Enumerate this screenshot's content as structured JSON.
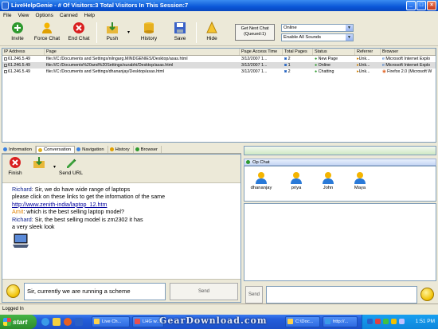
{
  "window": {
    "title": "LiveHelpGenie - # Of Visitors:3 Total Visitors In This Session:7"
  },
  "menu": [
    "File",
    "View",
    "Options",
    "Canned",
    "Help"
  ],
  "toolbar": {
    "invite": "Invite",
    "force_chat": "Force Chat",
    "end_chat": "End Chat",
    "push": "Push",
    "history": "History",
    "save": "Save",
    "hide": "Hide",
    "get_next_chat": "Get Next Chat",
    "queued": "(Queued:1)",
    "status_value": "Online",
    "sound_value": "Enable All Sounds"
  },
  "visitors": {
    "columns": [
      "IP Address",
      "Page",
      "Page Access Time",
      "Total Pages",
      "Status",
      "Referrer",
      "Browser"
    ],
    "rows": [
      {
        "ip": "61.246.5.49",
        "page": "file:///C:/Documents and Settings/nilngarg.MINDGENIES/Desktop/asas.html",
        "time": "3/12/2007 1...",
        "pages": "2",
        "status": "New Page",
        "referrer": "Unk...",
        "browser": "Microsoft Internet Explo"
      },
      {
        "ip": "61.246.5.49",
        "page": "file:///C:/Documents%20and%20Settings/surabhi/Desktop/asas.html",
        "time": "3/12/2007 1...",
        "pages": "1",
        "status": "Online",
        "referrer": "Unk...",
        "browser": "Microsoft Internet Explo"
      },
      {
        "ip": "61.246.5.49",
        "page": "file:///C:/Documents and Settings/dhananjay/Desktop/asas.html",
        "time": "3/12/2007 1...",
        "pages": "2",
        "status": "Chatting",
        "referrer": "Unk...",
        "browser": "Firefox 2.0 (Microsoft W"
      }
    ]
  },
  "tabs": [
    "Information",
    "Conversation",
    "Navigation",
    "History",
    "Browser"
  ],
  "conversation": {
    "finish": "Finish",
    "send_url": "Send URL",
    "lines": [
      {
        "speaker": "Richard",
        "text": ": Sir, we do have wide range of laptops"
      },
      {
        "speaker": "",
        "text": "please click on these links to get the information of the same"
      },
      {
        "speaker": "",
        "link": "http://www.zenith-india/laptop_12.htm"
      },
      {
        "speaker": "Amit",
        "text": ": which is the best selling laptop model?"
      },
      {
        "speaker": "Richard",
        "text": ": Sir, the best selling model is zm2302 it has"
      },
      {
        "speaker": "",
        "text": "a very sleek look"
      }
    ],
    "input": "Sir, currently we are running a scheme",
    "send": "Send"
  },
  "op_chat": {
    "tab": "Op Chat",
    "operators": [
      "dhananjay",
      "priya",
      "John",
      "Maya"
    ],
    "send": "Send"
  },
  "status_bar": "Logged In",
  "taskbar": {
    "start": "start",
    "tasks": [
      "Live Ch...",
      "LHG w...",
      "C:\\Doc...",
      "http://..."
    ],
    "clock": "1:51 PM"
  },
  "watermark": "GearDownload.com",
  "colors": {
    "accent": "#0a57d8",
    "chat_blue": "#0b1f8c",
    "chat_orange": "#e08000"
  }
}
